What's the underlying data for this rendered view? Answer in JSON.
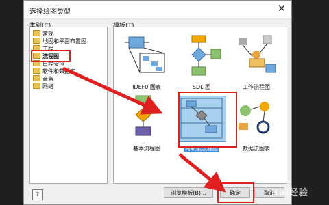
{
  "dialog": {
    "title": "选择绘图类型",
    "close_icon": "close-icon"
  },
  "categories": {
    "label": "类别(C)",
    "items": [
      {
        "label": "常规"
      },
      {
        "label": "地图和平面布置图"
      },
      {
        "label": "工程"
      },
      {
        "label": "流程图",
        "selected": true
      },
      {
        "label": "日程安排"
      },
      {
        "label": "软件和数据库"
      },
      {
        "label": "商务"
      },
      {
        "label": "网络"
      }
    ]
  },
  "templates": {
    "label": "模板(T)",
    "items": [
      {
        "name": "IDEF0 图表"
      },
      {
        "name": "SDL 图"
      },
      {
        "name": "工作流程图"
      },
      {
        "name": "基本流程图"
      },
      {
        "name": "跨职能流程图",
        "selected": true
      },
      {
        "name": "数据流图表"
      }
    ]
  },
  "buttons": {
    "help": "?",
    "browse": "浏览模板(B)...",
    "ok": "确定",
    "cancel": "取消"
  },
  "watermark": "Bai经验",
  "colors": {
    "highlight_red": "#e02020",
    "selection_blue": "#3a8ee6"
  }
}
